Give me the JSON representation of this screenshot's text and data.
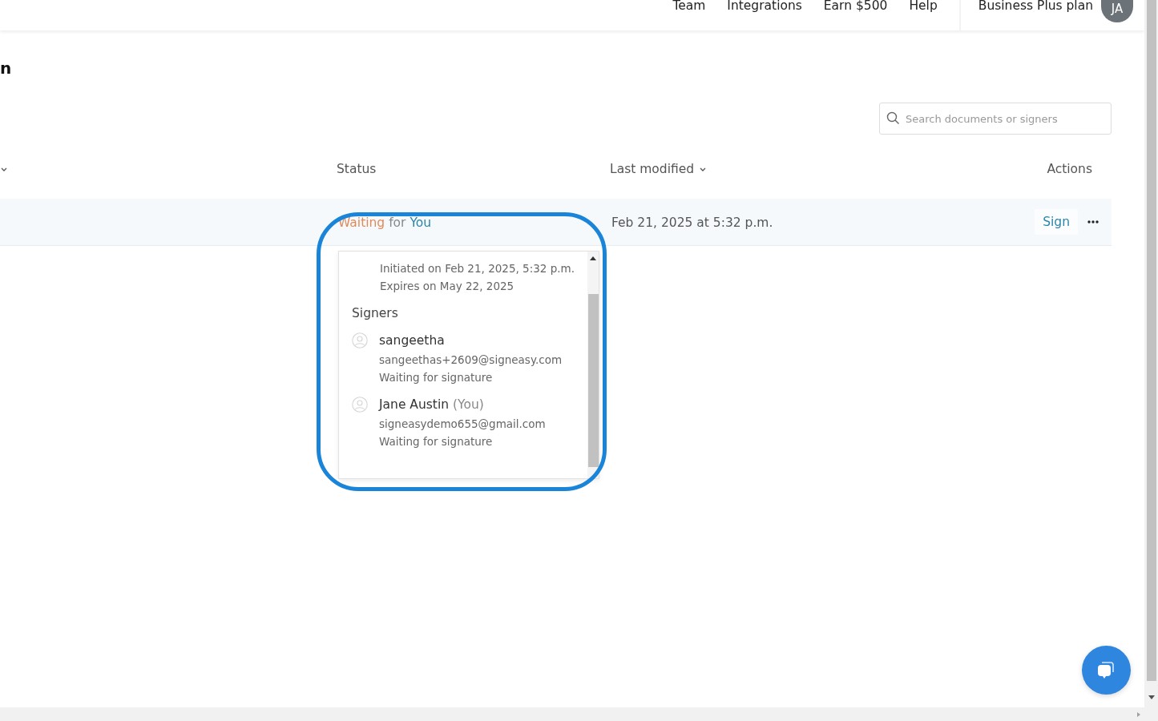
{
  "nav": {
    "links": [
      "Team",
      "Integrations",
      "Earn $500",
      "Help"
    ],
    "plan": "Business Plus plan",
    "avatar": "JA"
  },
  "page": {
    "title": "n"
  },
  "search": {
    "placeholder": "Search documents or signers"
  },
  "table": {
    "columns": [
      {
        "kind": "sortable"
      },
      {
        "kind": "plain",
        "label": "Status"
      },
      {
        "kind": "sortable",
        "label": "Last modified"
      },
      {
        "kind": "plain",
        "label": "Actions"
      }
    ],
    "rows": [
      {
        "status": {
          "state": "Waiting",
          "connector": "for",
          "party": "You"
        },
        "last_modified": "Feb 21, 2025 at 5:32 p.m.",
        "action": "Sign",
        "popover": {
          "details": [
            "Initiated on Feb 21, 2025, 5:32 p.m.",
            "Expires on May 22, 2025"
          ],
          "heading": "Signers",
          "signers": [
            {
              "name": "sangeetha",
              "email": "sangeethas+2609@signeasy.com",
              "status": "Waiting for signature"
            },
            {
              "name": "Jane Austin",
              "tag": "(You)",
              "email": "signeasydemo655@gmail.com",
              "status": "Waiting for signature"
            }
          ]
        }
      }
    ]
  }
}
